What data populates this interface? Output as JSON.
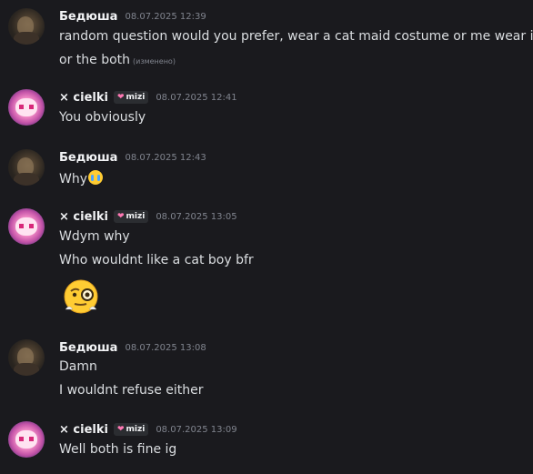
{
  "messages": [
    {
      "author": "Бедюша",
      "time": "08.07.2025 12:39",
      "lines": [
        "random question would you prefer, wear a cat maid costume or me wear it",
        "or the both"
      ],
      "edited": "(изменено)"
    },
    {
      "author": "× cielki",
      "tag": "mizi",
      "time": "08.07.2025 12:41",
      "lines": [
        "You obviously"
      ]
    },
    {
      "author": "Бедюша",
      "time": "08.07.2025 12:43",
      "lines": [
        "Why"
      ],
      "emoji": "loudly-crying-face-emoji"
    },
    {
      "author": "× cielki",
      "tag": "mizi",
      "time": "08.07.2025 13:05",
      "lines": [
        "Wdym why",
        "Who wouldnt like a cat boy bfr"
      ],
      "sticker": "monocle-face-emoji"
    },
    {
      "author": "Бедюша",
      "time": "08.07.2025 13:08",
      "lines": [
        "Damn",
        "I wouldnt refuse either"
      ]
    },
    {
      "author": "× cielki",
      "tag": "mizi",
      "time": "08.07.2025 13:09",
      "lines": [
        "Well both is fine ig"
      ]
    }
  ]
}
